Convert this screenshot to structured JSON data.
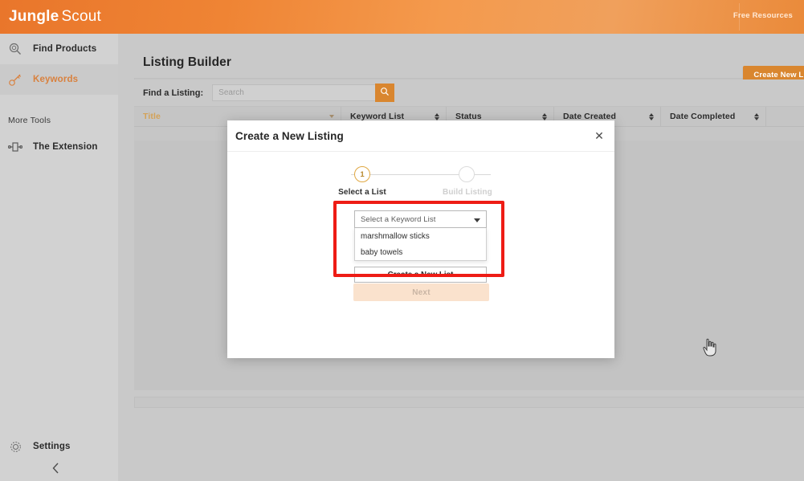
{
  "topbar": {
    "logo_primary": "Jungle",
    "logo_secondary": "Scout",
    "free_resources": "Free Resources",
    "brand_orange": "#e9762b"
  },
  "sidebar": {
    "items": [
      {
        "label": "Find Products",
        "icon": "magnifier-icon",
        "active": false
      },
      {
        "label": "Keywords",
        "icon": "key-icon",
        "active": true
      }
    ],
    "more_tools_header": "More Tools",
    "tools": [
      {
        "label": "The Extension",
        "icon": "extension-icon"
      }
    ],
    "settings_label": "Settings",
    "settings_icon": "gear-icon",
    "collapse_icon": "chevron-left-icon"
  },
  "page": {
    "title": "Listing Builder",
    "create_button": "Create New Listing",
    "find_label": "Find a Listing:",
    "search_placeholder": "Search",
    "search_value": "",
    "search_icon": "search-icon"
  },
  "table": {
    "columns": [
      {
        "label": "Title",
        "sort": "desc",
        "active": true
      },
      {
        "label": "Keyword List",
        "sort": "both",
        "active": false
      },
      {
        "label": "Status",
        "sort": "both",
        "active": false
      },
      {
        "label": "Date Created",
        "sort": "both",
        "active": false
      },
      {
        "label": "Date Completed",
        "sort": "both",
        "active": false
      }
    ],
    "rows": []
  },
  "modal": {
    "title": "Create a New Listing",
    "close_icon": "close-icon",
    "steps": [
      {
        "number": "1",
        "label": "Select a List",
        "state": "active"
      },
      {
        "number": "2",
        "label": "Build Listing",
        "state": "inactive"
      }
    ],
    "select": {
      "value": "Select a Keyword List",
      "caret_icon": "chevron-down-icon",
      "options": [
        "marshmallow sticks",
        "baby towels"
      ]
    },
    "create_list_button": "Create a New List",
    "next_button": "Next",
    "highlight_color": "#ee1c15"
  },
  "cursor": {
    "icon": "pointing-hand-cursor"
  }
}
